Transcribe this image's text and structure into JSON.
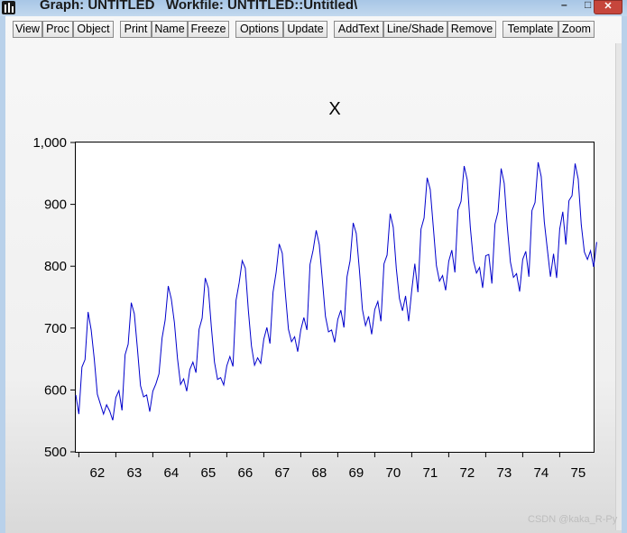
{
  "window": {
    "title": "Graph: UNTITLED   Workfile: UNTITLED::Untitled\\",
    "minimize_glyph": "–",
    "maximize_glyph": "□",
    "close_glyph": "✕"
  },
  "toolbar": {
    "buttons": [
      "View",
      "Proc",
      "Object",
      "Print",
      "Name",
      "Freeze",
      "Options",
      "Update",
      "AddText",
      "Line/Shade",
      "Remove",
      "Template",
      "Zoom"
    ]
  },
  "watermark": "CSDN @kaka_R-Py",
  "colors": {
    "series": "#0000cc",
    "window_frame": "#b9d1ea"
  },
  "chart_data": {
    "type": "line",
    "title": "X",
    "xlabel": "",
    "ylabel": "",
    "x_ticks": [
      "62",
      "63",
      "64",
      "65",
      "66",
      "67",
      "68",
      "69",
      "70",
      "71",
      "72",
      "73",
      "74",
      "75"
    ],
    "y_ticks": [
      "500",
      "600",
      "700",
      "800",
      "900",
      "1,000"
    ],
    "ylim": [
      500,
      1000
    ],
    "x_range": [
      1961.917,
      1975.917
    ],
    "grid": false,
    "legend": "none",
    "series": [
      {
        "frequency": "monthly",
        "start": "1961-12",
        "values": [
          592,
          561,
          637,
          649,
          726,
          697,
          650,
          593,
          577,
          561,
          576,
          566,
          551,
          588,
          599,
          567,
          657,
          674,
          741,
          723,
          667,
          607,
          589,
          592,
          565,
          598,
          610,
          626,
          684,
          713,
          768,
          747,
          709,
          651,
          609,
          618,
          598,
          633,
          645,
          628,
          698,
          716,
          781,
          765,
          701,
          645,
          617,
          620,
          608,
          639,
          654,
          638,
          745,
          773,
          809,
          797,
          728,
          671,
          640,
          652,
          643,
          682,
          701,
          675,
          758,
          790,
          836,
          821,
          756,
          698,
          678,
          686,
          662,
          697,
          717,
          697,
          803,
          826,
          858,
          835,
          778,
          719,
          694,
          697,
          677,
          714,
          729,
          701,
          783,
          809,
          870,
          853,
          795,
          730,
          704,
          719,
          690,
          730,
          743,
          711,
          804,
          818,
          885,
          863,
          796,
          748,
          728,
          752,
          711,
          761,
          804,
          758,
          860,
          878,
          943,
          924,
          863,
          801,
          776,
          785,
          761,
          808,
          826,
          790,
          891,
          905,
          962,
          940,
          863,
          809,
          789,
          798,
          765,
          817,
          819,
          772,
          868,
          888,
          958,
          934,
          864,
          807,
          782,
          788,
          759,
          811,
          824,
          783,
          890,
          903,
          968,
          945,
          872,
          827,
          783,
          820,
          781,
          860,
          888,
          835,
          906,
          914,
          966,
          941,
          867,
          823,
          811,
          825,
          799,
          839
        ]
      }
    ]
  }
}
